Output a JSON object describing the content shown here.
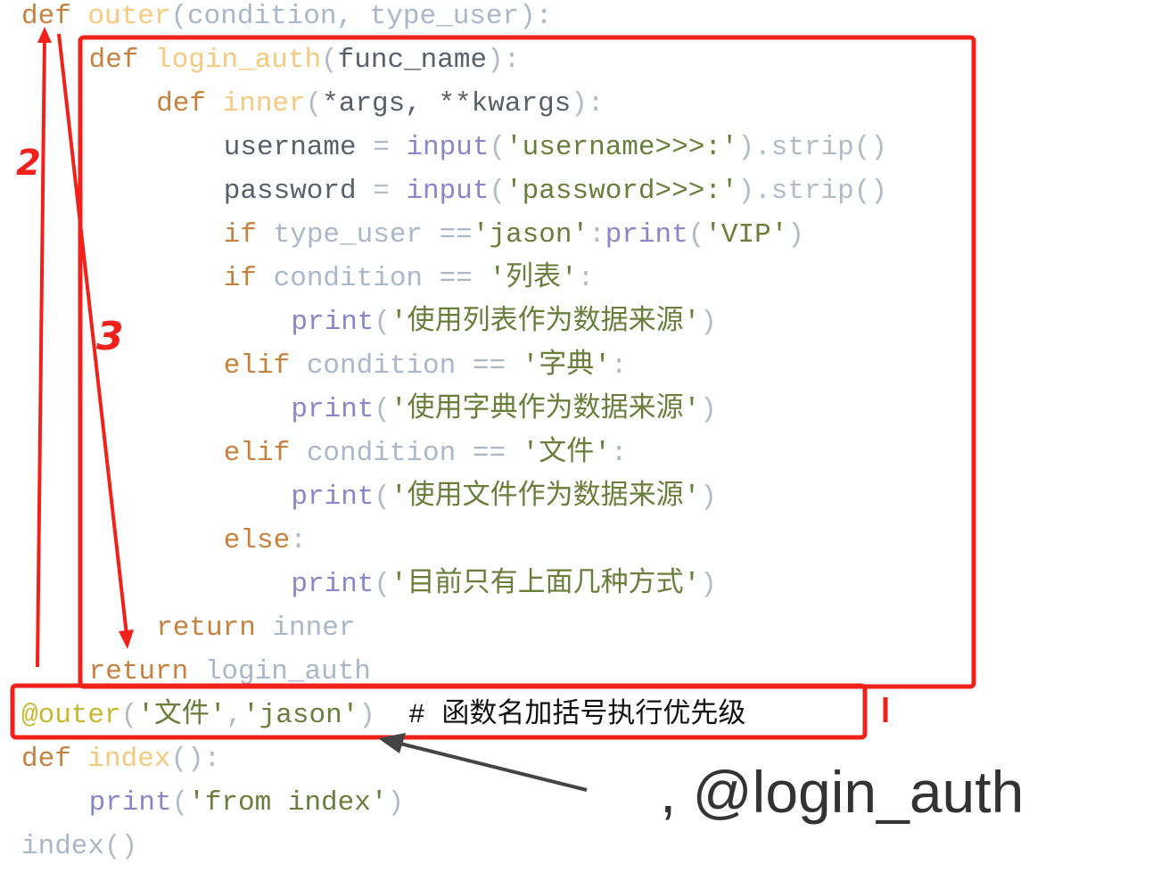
{
  "code": {
    "lines": [
      {
        "indent": 0,
        "tokens": [
          {
            "t": "def ",
            "c": "kw"
          },
          {
            "t": "outer",
            "c": "fn"
          },
          {
            "t": "(condition, type_user):",
            "c": "pa"
          }
        ]
      },
      {
        "indent": 4,
        "tokens": [
          {
            "t": "def ",
            "c": "kw"
          },
          {
            "t": "login_auth",
            "c": "fn"
          },
          {
            "t": "(",
            "c": "pu"
          },
          {
            "t": "func_name",
            "c": "id"
          },
          {
            "t": "):",
            "c": "pu"
          }
        ]
      },
      {
        "indent": 8,
        "tokens": [
          {
            "t": "def ",
            "c": "kw"
          },
          {
            "t": "inner",
            "c": "fn"
          },
          {
            "t": "(",
            "c": "pu"
          },
          {
            "t": "*args, **kwargs",
            "c": "id"
          },
          {
            "t": "):",
            "c": "pu"
          }
        ]
      },
      {
        "indent": 12,
        "tokens": [
          {
            "t": "username ",
            "c": "id"
          },
          {
            "t": "= ",
            "c": "pu"
          },
          {
            "t": "input",
            "c": "bi"
          },
          {
            "t": "(",
            "c": "pu"
          },
          {
            "t": "'username>>>:'",
            "c": "st"
          },
          {
            "t": ").strip()",
            "c": "pu"
          }
        ]
      },
      {
        "indent": 12,
        "tokens": [
          {
            "t": "password ",
            "c": "id"
          },
          {
            "t": "= ",
            "c": "pu"
          },
          {
            "t": "input",
            "c": "bi"
          },
          {
            "t": "(",
            "c": "pu"
          },
          {
            "t": "'password>>>:'",
            "c": "st"
          },
          {
            "t": ").strip()",
            "c": "pu"
          }
        ]
      },
      {
        "indent": 12,
        "tokens": [
          {
            "t": "if ",
            "c": "kw"
          },
          {
            "t": "type_user ==",
            "c": "pa"
          },
          {
            "t": "'jason'",
            "c": "st"
          },
          {
            "t": ":",
            "c": "pu"
          },
          {
            "t": "print",
            "c": "bi"
          },
          {
            "t": "(",
            "c": "pu"
          },
          {
            "t": "'VIP'",
            "c": "st"
          },
          {
            "t": ")",
            "c": "pu"
          }
        ]
      },
      {
        "indent": 12,
        "tokens": [
          {
            "t": "if ",
            "c": "kw"
          },
          {
            "t": "condition == ",
            "c": "pa"
          },
          {
            "t": "'列表'",
            "c": "st"
          },
          {
            "t": ":",
            "c": "pu"
          }
        ]
      },
      {
        "indent": 16,
        "tokens": [
          {
            "t": "print",
            "c": "bi"
          },
          {
            "t": "(",
            "c": "pu"
          },
          {
            "t": "'使用列表作为数据来源'",
            "c": "st"
          },
          {
            "t": ")",
            "c": "pu"
          }
        ]
      },
      {
        "indent": 12,
        "tokens": [
          {
            "t": "elif ",
            "c": "kw"
          },
          {
            "t": "condition == ",
            "c": "pa"
          },
          {
            "t": "'字典'",
            "c": "st"
          },
          {
            "t": ":",
            "c": "pu"
          }
        ]
      },
      {
        "indent": 16,
        "tokens": [
          {
            "t": "print",
            "c": "bi"
          },
          {
            "t": "(",
            "c": "pu"
          },
          {
            "t": "'使用字典作为数据来源'",
            "c": "st"
          },
          {
            "t": ")",
            "c": "pu"
          }
        ]
      },
      {
        "indent": 12,
        "tokens": [
          {
            "t": "elif ",
            "c": "kw"
          },
          {
            "t": "condition == ",
            "c": "pa"
          },
          {
            "t": "'文件'",
            "c": "st"
          },
          {
            "t": ":",
            "c": "pu"
          }
        ]
      },
      {
        "indent": 16,
        "tokens": [
          {
            "t": "print",
            "c": "bi"
          },
          {
            "t": "(",
            "c": "pu"
          },
          {
            "t": "'使用文件作为数据来源'",
            "c": "st"
          },
          {
            "t": ")",
            "c": "pu"
          }
        ]
      },
      {
        "indent": 12,
        "tokens": [
          {
            "t": "else",
            "c": "kw"
          },
          {
            "t": ":",
            "c": "pu"
          }
        ]
      },
      {
        "indent": 16,
        "tokens": [
          {
            "t": "print",
            "c": "bi"
          },
          {
            "t": "(",
            "c": "pu"
          },
          {
            "t": "'目前只有上面几种方式'",
            "c": "st"
          },
          {
            "t": ")",
            "c": "pu"
          }
        ]
      },
      {
        "indent": 8,
        "tokens": [
          {
            "t": "return ",
            "c": "kw"
          },
          {
            "t": "inner",
            "c": "pa"
          }
        ]
      },
      {
        "indent": 4,
        "tokens": [
          {
            "t": "return ",
            "c": "kw"
          },
          {
            "t": "login_auth",
            "c": "pa"
          }
        ]
      },
      {
        "indent": 0,
        "tokens": [
          {
            "t": "@outer",
            "c": "dec"
          },
          {
            "t": "(",
            "c": "pu"
          },
          {
            "t": "'文件'",
            "c": "st"
          },
          {
            "t": ",",
            "c": "pu"
          },
          {
            "t": "'jason'",
            "c": "st"
          },
          {
            "t": ")  ",
            "c": "pu"
          },
          {
            "t": "# 函数名加括号执行优先级",
            "c": "cm"
          }
        ]
      },
      {
        "indent": 0,
        "tokens": [
          {
            "t": "def ",
            "c": "kw"
          },
          {
            "t": "index",
            "c": "fn"
          },
          {
            "t": "():",
            "c": "pu"
          }
        ]
      },
      {
        "indent": 4,
        "tokens": [
          {
            "t": "print",
            "c": "bi"
          },
          {
            "t": "(",
            "c": "pu"
          },
          {
            "t": "'from index'",
            "c": "st"
          },
          {
            "t": ")",
            "c": "pu"
          }
        ]
      },
      {
        "indent": 0,
        "tokens": [
          {
            "t": "index",
            "c": "pa"
          },
          {
            "t": "()",
            "c": "pu"
          }
        ]
      }
    ]
  },
  "annotations": {
    "step_1": "1",
    "step_2": "2",
    "step_3": "3",
    "equivalent_text": ", @login_auth",
    "highlight_color": "#f0201a",
    "arrow_color": "#444444"
  }
}
